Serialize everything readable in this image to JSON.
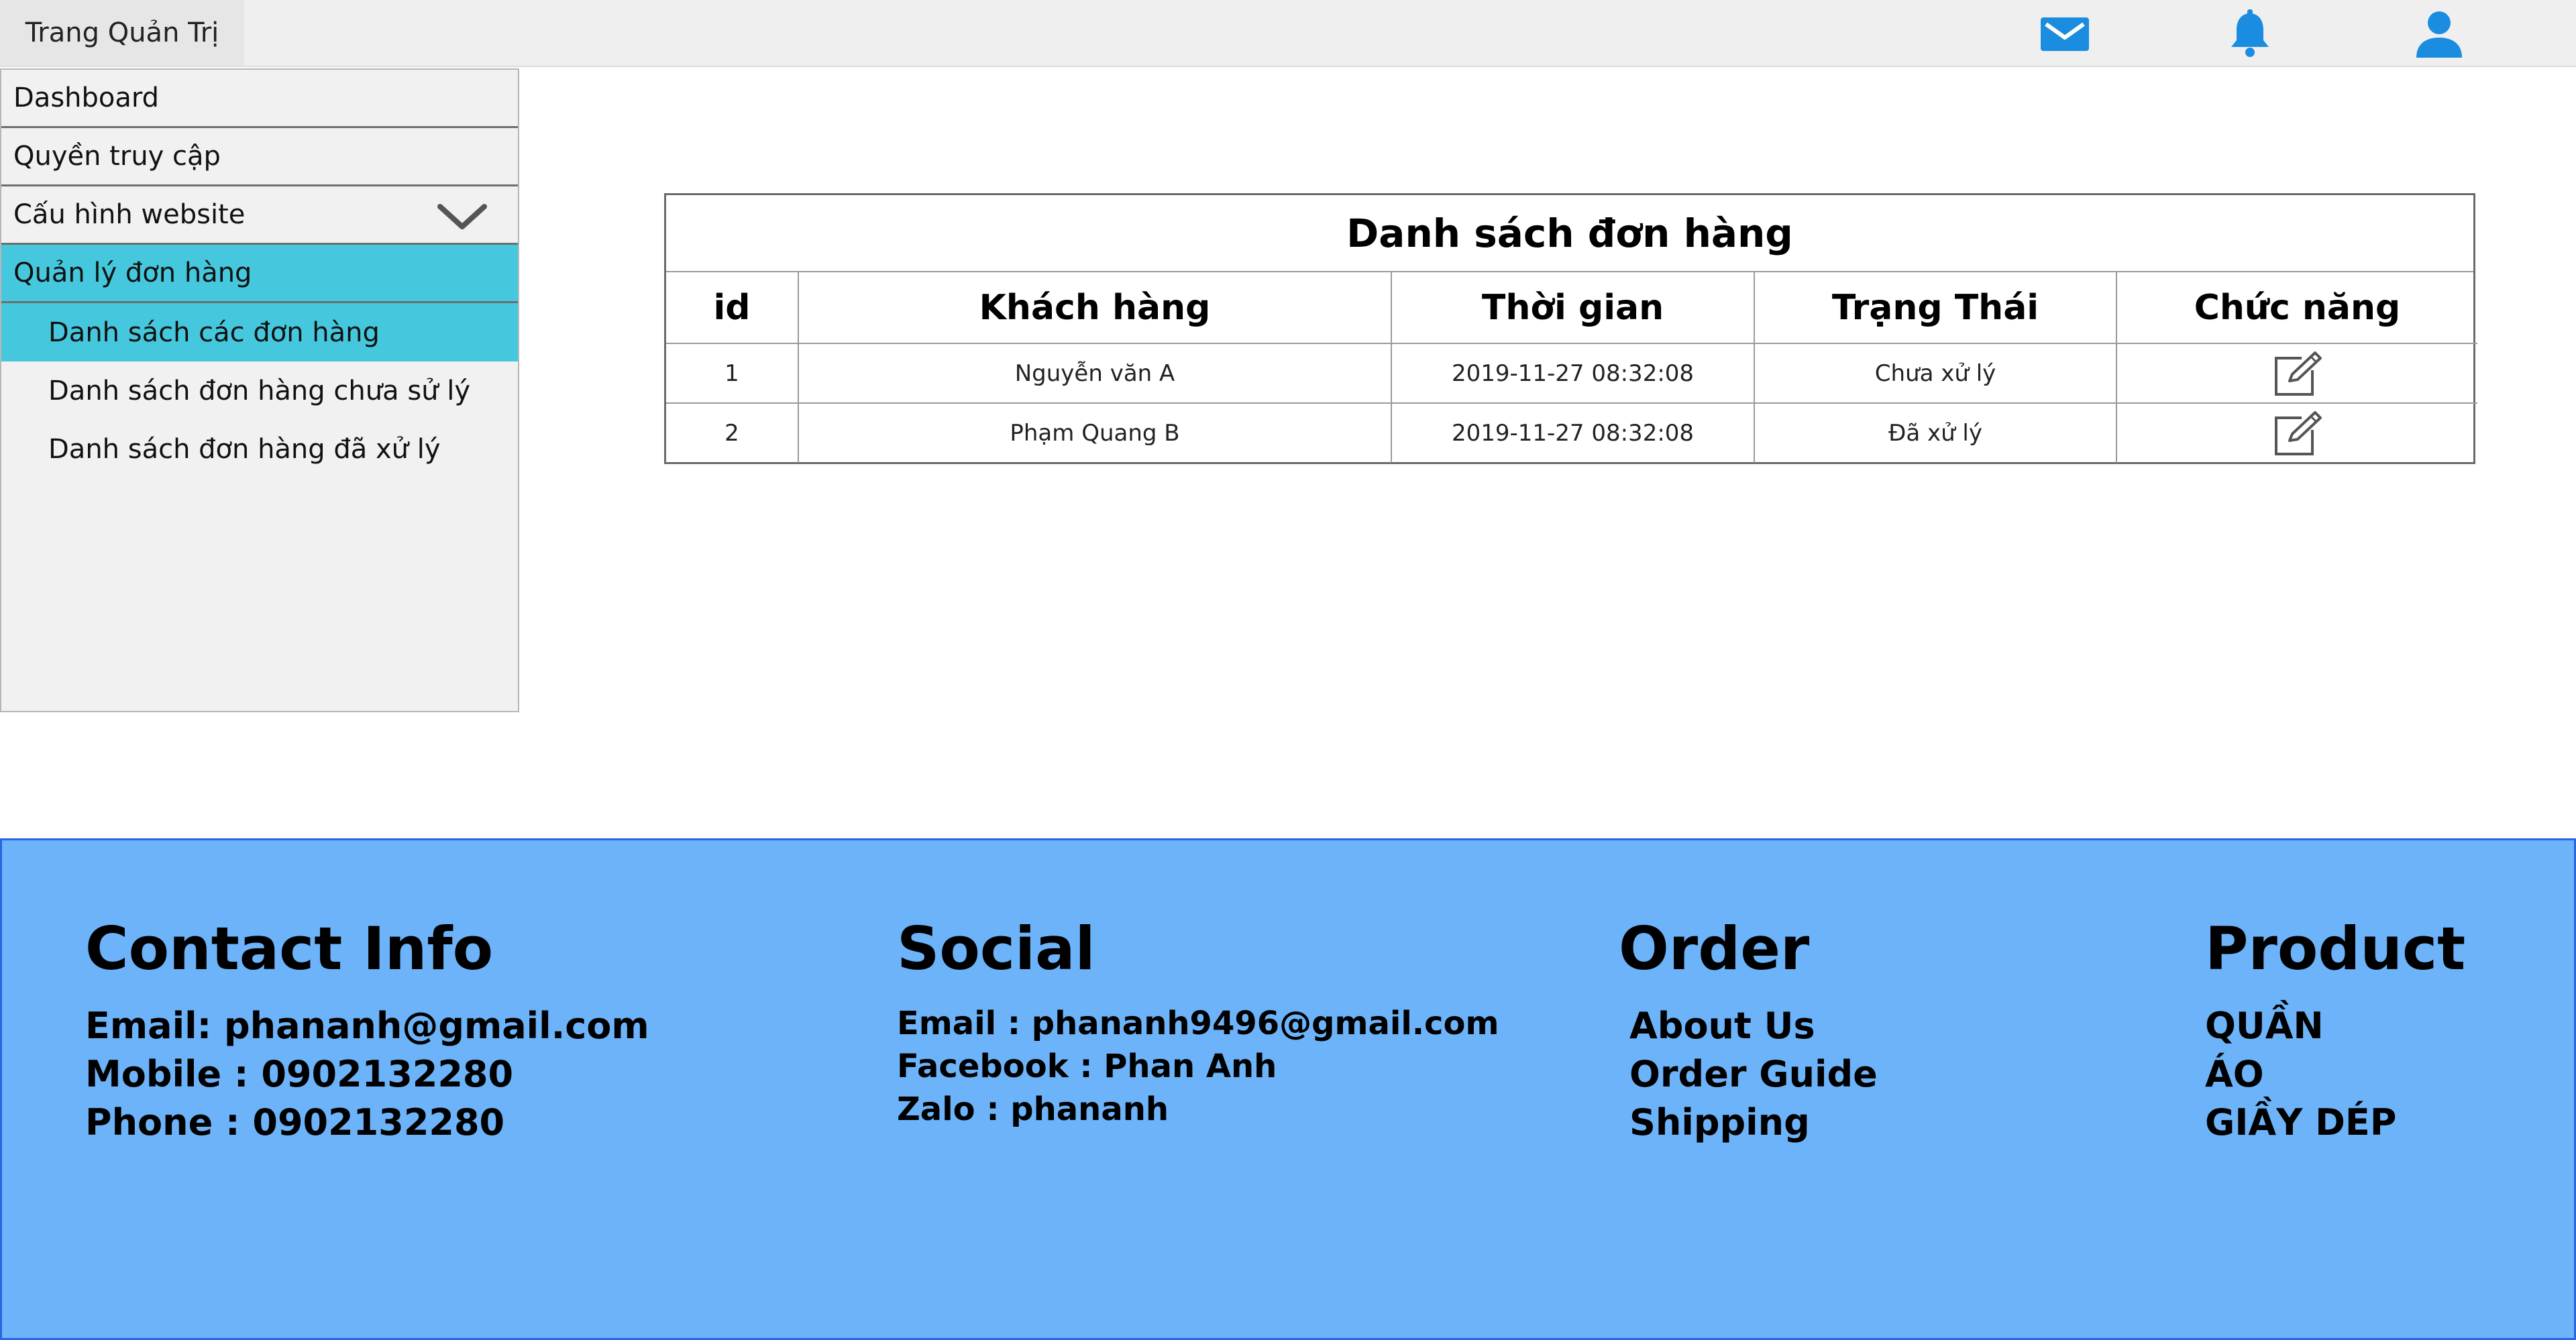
{
  "header": {
    "brand": "Trang Quản Trị",
    "icons": [
      "mail-icon",
      "bell-icon",
      "user-icon"
    ],
    "icon_color": "#1a8de0"
  },
  "sidebar": {
    "items": [
      {
        "label": "Dashboard"
      },
      {
        "label": "Quyền truy cập"
      },
      {
        "label": "Cấu hình website",
        "icon": "chevron-down-icon"
      },
      {
        "label": "Quản lý đơn hàng",
        "active": true
      }
    ],
    "subitems": [
      {
        "label": "Danh sách các đơn hàng",
        "active": true
      },
      {
        "label": "Danh sách đơn hàng chưa sử lý"
      },
      {
        "label": "Danh sách đơn hàng đã xử lý"
      }
    ],
    "active_color": "#45c8dd"
  },
  "orders": {
    "title": "Danh sách đơn hàng",
    "columns": [
      "id",
      "Khách hàng",
      "Thời gian",
      "Trạng Thái",
      "Chức năng"
    ],
    "rows": [
      {
        "id": "1",
        "customer": "Nguyễn văn A",
        "time": "2019-11-27 08:32:08",
        "status": "Chưa xử lý",
        "action_icon": "edit-icon"
      },
      {
        "id": "2",
        "customer": "Phạm Quang B",
        "time": "2019-11-27 08:32:08",
        "status": "Đã xử lý",
        "action_icon": "edit-icon"
      }
    ]
  },
  "footer": {
    "background": "#6cb3f9",
    "contact": {
      "title": "Contact Info",
      "lines": [
        "Email: phananh@gmail.com",
        "Mobile : 0902132280",
        "Phone : 0902132280"
      ]
    },
    "social": {
      "title": "Social",
      "lines": [
        "Email : phananh9496@gmail.com",
        "Facebook : Phan Anh",
        "Zalo : phananh"
      ]
    },
    "order": {
      "title": "Order",
      "links": [
        "About Us",
        "Order Guide",
        "Shipping"
      ]
    },
    "product": {
      "title": "Product",
      "links": [
        "QUẦN",
        "ÁO",
        "GIẦY DÉP"
      ]
    }
  }
}
